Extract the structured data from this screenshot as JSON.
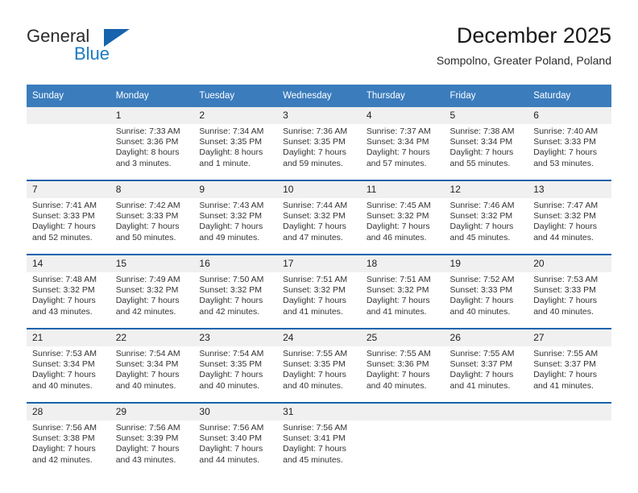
{
  "brand": {
    "name_part1": "General",
    "name_part2": "Blue",
    "flag_icon": "blue-triangle-flag-icon",
    "accent_color": "#1763ad"
  },
  "header": {
    "title": "December 2025",
    "subtitle": "Sompolno, Greater Poland, Poland"
  },
  "theme": {
    "header_bg": "#3b7cbd",
    "daynum_bg": "#f0f0f0",
    "separator": "#1763ad",
    "text": "#333333"
  },
  "calendar": {
    "weekday_headers": [
      "Sunday",
      "Monday",
      "Tuesday",
      "Wednesday",
      "Thursday",
      "Friday",
      "Saturday"
    ],
    "weeks": [
      [
        {
          "day": "",
          "sunrise": "",
          "sunset": "",
          "daylight_1": "",
          "daylight_2": ""
        },
        {
          "day": "1",
          "sunrise": "Sunrise: 7:33 AM",
          "sunset": "Sunset: 3:36 PM",
          "daylight_1": "Daylight: 8 hours",
          "daylight_2": "and 3 minutes."
        },
        {
          "day": "2",
          "sunrise": "Sunrise: 7:34 AM",
          "sunset": "Sunset: 3:35 PM",
          "daylight_1": "Daylight: 8 hours",
          "daylight_2": "and 1 minute."
        },
        {
          "day": "3",
          "sunrise": "Sunrise: 7:36 AM",
          "sunset": "Sunset: 3:35 PM",
          "daylight_1": "Daylight: 7 hours",
          "daylight_2": "and 59 minutes."
        },
        {
          "day": "4",
          "sunrise": "Sunrise: 7:37 AM",
          "sunset": "Sunset: 3:34 PM",
          "daylight_1": "Daylight: 7 hours",
          "daylight_2": "and 57 minutes."
        },
        {
          "day": "5",
          "sunrise": "Sunrise: 7:38 AM",
          "sunset": "Sunset: 3:34 PM",
          "daylight_1": "Daylight: 7 hours",
          "daylight_2": "and 55 minutes."
        },
        {
          "day": "6",
          "sunrise": "Sunrise: 7:40 AM",
          "sunset": "Sunset: 3:33 PM",
          "daylight_1": "Daylight: 7 hours",
          "daylight_2": "and 53 minutes."
        }
      ],
      [
        {
          "day": "7",
          "sunrise": "Sunrise: 7:41 AM",
          "sunset": "Sunset: 3:33 PM",
          "daylight_1": "Daylight: 7 hours",
          "daylight_2": "and 52 minutes."
        },
        {
          "day": "8",
          "sunrise": "Sunrise: 7:42 AM",
          "sunset": "Sunset: 3:33 PM",
          "daylight_1": "Daylight: 7 hours",
          "daylight_2": "and 50 minutes."
        },
        {
          "day": "9",
          "sunrise": "Sunrise: 7:43 AM",
          "sunset": "Sunset: 3:32 PM",
          "daylight_1": "Daylight: 7 hours",
          "daylight_2": "and 49 minutes."
        },
        {
          "day": "10",
          "sunrise": "Sunrise: 7:44 AM",
          "sunset": "Sunset: 3:32 PM",
          "daylight_1": "Daylight: 7 hours",
          "daylight_2": "and 47 minutes."
        },
        {
          "day": "11",
          "sunrise": "Sunrise: 7:45 AM",
          "sunset": "Sunset: 3:32 PM",
          "daylight_1": "Daylight: 7 hours",
          "daylight_2": "and 46 minutes."
        },
        {
          "day": "12",
          "sunrise": "Sunrise: 7:46 AM",
          "sunset": "Sunset: 3:32 PM",
          "daylight_1": "Daylight: 7 hours",
          "daylight_2": "and 45 minutes."
        },
        {
          "day": "13",
          "sunrise": "Sunrise: 7:47 AM",
          "sunset": "Sunset: 3:32 PM",
          "daylight_1": "Daylight: 7 hours",
          "daylight_2": "and 44 minutes."
        }
      ],
      [
        {
          "day": "14",
          "sunrise": "Sunrise: 7:48 AM",
          "sunset": "Sunset: 3:32 PM",
          "daylight_1": "Daylight: 7 hours",
          "daylight_2": "and 43 minutes."
        },
        {
          "day": "15",
          "sunrise": "Sunrise: 7:49 AM",
          "sunset": "Sunset: 3:32 PM",
          "daylight_1": "Daylight: 7 hours",
          "daylight_2": "and 42 minutes."
        },
        {
          "day": "16",
          "sunrise": "Sunrise: 7:50 AM",
          "sunset": "Sunset: 3:32 PM",
          "daylight_1": "Daylight: 7 hours",
          "daylight_2": "and 42 minutes."
        },
        {
          "day": "17",
          "sunrise": "Sunrise: 7:51 AM",
          "sunset": "Sunset: 3:32 PM",
          "daylight_1": "Daylight: 7 hours",
          "daylight_2": "and 41 minutes."
        },
        {
          "day": "18",
          "sunrise": "Sunrise: 7:51 AM",
          "sunset": "Sunset: 3:32 PM",
          "daylight_1": "Daylight: 7 hours",
          "daylight_2": "and 41 minutes."
        },
        {
          "day": "19",
          "sunrise": "Sunrise: 7:52 AM",
          "sunset": "Sunset: 3:33 PM",
          "daylight_1": "Daylight: 7 hours",
          "daylight_2": "and 40 minutes."
        },
        {
          "day": "20",
          "sunrise": "Sunrise: 7:53 AM",
          "sunset": "Sunset: 3:33 PM",
          "daylight_1": "Daylight: 7 hours",
          "daylight_2": "and 40 minutes."
        }
      ],
      [
        {
          "day": "21",
          "sunrise": "Sunrise: 7:53 AM",
          "sunset": "Sunset: 3:34 PM",
          "daylight_1": "Daylight: 7 hours",
          "daylight_2": "and 40 minutes."
        },
        {
          "day": "22",
          "sunrise": "Sunrise: 7:54 AM",
          "sunset": "Sunset: 3:34 PM",
          "daylight_1": "Daylight: 7 hours",
          "daylight_2": "and 40 minutes."
        },
        {
          "day": "23",
          "sunrise": "Sunrise: 7:54 AM",
          "sunset": "Sunset: 3:35 PM",
          "daylight_1": "Daylight: 7 hours",
          "daylight_2": "and 40 minutes."
        },
        {
          "day": "24",
          "sunrise": "Sunrise: 7:55 AM",
          "sunset": "Sunset: 3:35 PM",
          "daylight_1": "Daylight: 7 hours",
          "daylight_2": "and 40 minutes."
        },
        {
          "day": "25",
          "sunrise": "Sunrise: 7:55 AM",
          "sunset": "Sunset: 3:36 PM",
          "daylight_1": "Daylight: 7 hours",
          "daylight_2": "and 40 minutes."
        },
        {
          "day": "26",
          "sunrise": "Sunrise: 7:55 AM",
          "sunset": "Sunset: 3:37 PM",
          "daylight_1": "Daylight: 7 hours",
          "daylight_2": "and 41 minutes."
        },
        {
          "day": "27",
          "sunrise": "Sunrise: 7:55 AM",
          "sunset": "Sunset: 3:37 PM",
          "daylight_1": "Daylight: 7 hours",
          "daylight_2": "and 41 minutes."
        }
      ],
      [
        {
          "day": "28",
          "sunrise": "Sunrise: 7:56 AM",
          "sunset": "Sunset: 3:38 PM",
          "daylight_1": "Daylight: 7 hours",
          "daylight_2": "and 42 minutes."
        },
        {
          "day": "29",
          "sunrise": "Sunrise: 7:56 AM",
          "sunset": "Sunset: 3:39 PM",
          "daylight_1": "Daylight: 7 hours",
          "daylight_2": "and 43 minutes."
        },
        {
          "day": "30",
          "sunrise": "Sunrise: 7:56 AM",
          "sunset": "Sunset: 3:40 PM",
          "daylight_1": "Daylight: 7 hours",
          "daylight_2": "and 44 minutes."
        },
        {
          "day": "31",
          "sunrise": "Sunrise: 7:56 AM",
          "sunset": "Sunset: 3:41 PM",
          "daylight_1": "Daylight: 7 hours",
          "daylight_2": "and 45 minutes."
        },
        {
          "day": "",
          "sunrise": "",
          "sunset": "",
          "daylight_1": "",
          "daylight_2": ""
        },
        {
          "day": "",
          "sunrise": "",
          "sunset": "",
          "daylight_1": "",
          "daylight_2": ""
        },
        {
          "day": "",
          "sunrise": "",
          "sunset": "",
          "daylight_1": "",
          "daylight_2": ""
        }
      ]
    ]
  }
}
